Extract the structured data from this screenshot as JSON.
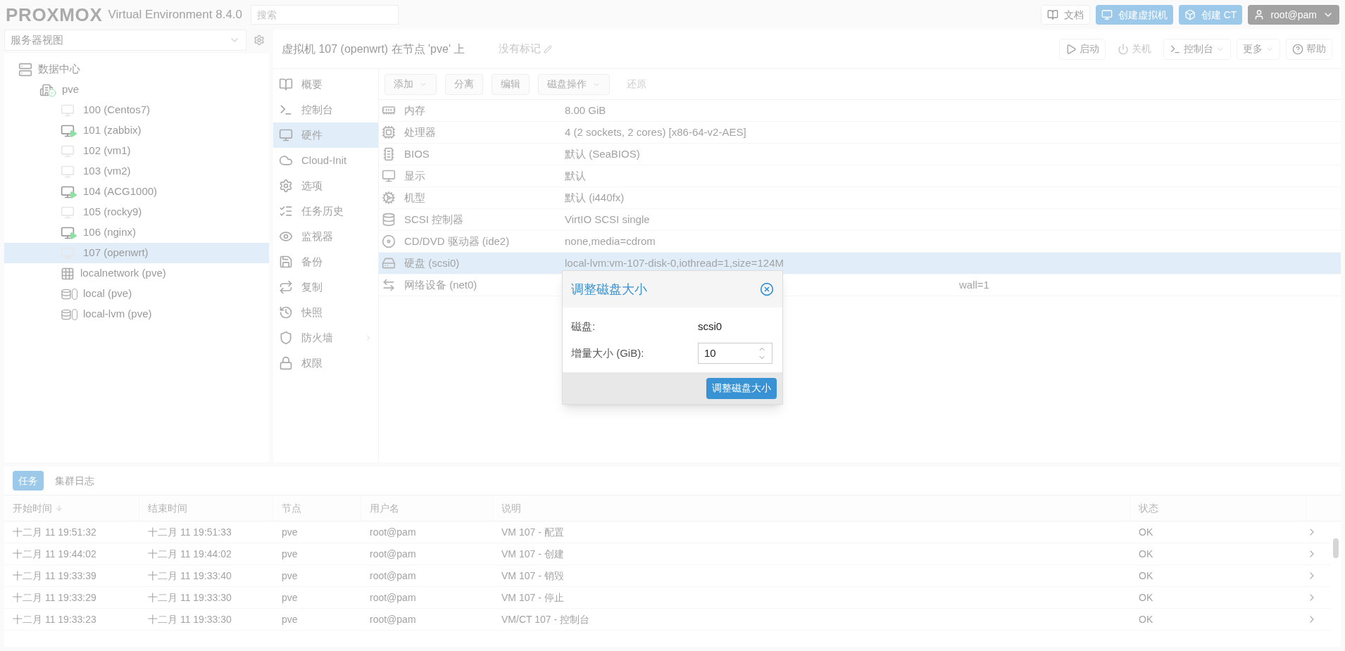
{
  "topbar": {
    "brand": "PROXMOX",
    "product": "Virtual Environment 8.4.0",
    "search": {
      "placeholder": "搜索"
    },
    "buttons": [
      {
        "label": "文档",
        "kind": "docs"
      },
      {
        "label": "创建虚拟机",
        "kind": "create-vm"
      },
      {
        "label": "创建 CT",
        "kind": "create-ct"
      },
      {
        "label": "root@pam",
        "kind": "user"
      }
    ]
  },
  "sidebar": {
    "view_select": {
      "value": "服务器视图"
    },
    "tree": [
      {
        "label": "数据中心",
        "kind": "datacenter",
        "selected": false,
        "children": [
          {
            "label": "pve",
            "kind": "node",
            "selected": false,
            "children": [
              {
                "label": "100 (Centos7)",
                "kind": "vm",
                "running": false,
                "selected": false
              },
              {
                "label": "101 (zabbix)",
                "kind": "vm",
                "running": true,
                "selected": false
              },
              {
                "label": "102 (vm1)",
                "kind": "vm",
                "running": false,
                "selected": false
              },
              {
                "label": "103 (vm2)",
                "kind": "vm",
                "running": false,
                "selected": false
              },
              {
                "label": "104 (ACG1000)",
                "kind": "vm",
                "running": true,
                "selected": false
              },
              {
                "label": "105 (rocky9)",
                "kind": "vm",
                "running": false,
                "selected": false
              },
              {
                "label": "106 (nginx)",
                "kind": "vm",
                "running": true,
                "selected": false
              },
              {
                "label": "107 (openwrt)",
                "kind": "vm",
                "running": false,
                "selected": true
              },
              {
                "label": "localnetwork (pve)",
                "kind": "sdn",
                "selected": false
              },
              {
                "label": "local (pve)",
                "kind": "storage",
                "selected": false
              },
              {
                "label": "local-lvm (pve)",
                "kind": "storage",
                "selected": false
              }
            ]
          }
        ]
      }
    ]
  },
  "content": {
    "title": "虚拟机 107 (openwrt) 在节点 'pve' 上",
    "tags": "没有标记",
    "actions": [
      {
        "label": "启动",
        "disabled": false
      },
      {
        "label": "关机",
        "disabled": true
      },
      {
        "label": "控制台",
        "disabled": false
      },
      {
        "label": "更多",
        "disabled": false
      },
      {
        "label": "帮助",
        "disabled": false
      }
    ],
    "nav": [
      {
        "label": "概要",
        "selected": false
      },
      {
        "label": "控制台",
        "selected": false
      },
      {
        "label": "硬件",
        "selected": true
      },
      {
        "label": "Cloud-Init",
        "selected": false
      },
      {
        "label": "选项",
        "selected": false
      },
      {
        "label": "任务历史",
        "selected": false
      },
      {
        "label": "监视器",
        "selected": false
      },
      {
        "label": "备份",
        "selected": false
      },
      {
        "label": "复制",
        "selected": false
      },
      {
        "label": "快照",
        "selected": false
      },
      {
        "label": "防火墙",
        "selected": false
      },
      {
        "label": "权限",
        "selected": false
      }
    ],
    "toolbar": [
      {
        "label": "添加",
        "disabled": false,
        "menu": true
      },
      {
        "label": "分离",
        "disabled": false,
        "menu": false
      },
      {
        "label": "编辑",
        "disabled": false,
        "menu": false
      },
      {
        "label": "磁盘操作",
        "disabled": false,
        "menu": true
      },
      {
        "label": "还原",
        "disabled": true,
        "menu": false
      }
    ],
    "hardware": [
      {
        "name": "内存",
        "value": "8.00 GiB",
        "selected": false,
        "covered": false
      },
      {
        "name": "处理器",
        "value": "4 (2 sockets, 2 cores) [x86-64-v2-AES]",
        "selected": false,
        "covered": false
      },
      {
        "name": "BIOS",
        "value": "默认 (SeaBIOS)",
        "selected": false,
        "covered": false
      },
      {
        "name": "显示",
        "value": "默认",
        "selected": false,
        "covered": false
      },
      {
        "name": "机型",
        "value": "默认 (i440fx)",
        "selected": false,
        "covered": false
      },
      {
        "name": "SCSI 控制器",
        "value": "VirtIO SCSI single",
        "selected": false,
        "covered": false
      },
      {
        "name": "CD/DVD 驱动器 (ide2)",
        "value": "none,media=cdrom",
        "selected": false,
        "covered": false
      },
      {
        "name": "硬盘 (scsi0)",
        "value": "local-lvm:vm-107-disk-0,iothread=1,size=124M",
        "selected": true,
        "covered": false
      },
      {
        "name": "网络设备 (net0)",
        "value": "wall=1",
        "selected": false,
        "covered": true
      }
    ]
  },
  "dialog": {
    "title": "调整磁盘大小",
    "fields": [
      {
        "label": "磁盘:",
        "kind": "display",
        "value": "scsi0"
      },
      {
        "label": "增量大小 (GiB):",
        "kind": "number",
        "value": "10"
      }
    ],
    "submit": "调整磁盘大小"
  },
  "log": {
    "tabs": [
      {
        "label": "任务",
        "selected": true
      },
      {
        "label": "集群日志",
        "selected": false
      }
    ],
    "columns": [
      "开始时间",
      "结束时间",
      "节点",
      "用户名",
      "说明",
      "状态"
    ],
    "rows": [
      [
        "十二月 11 19:51:32",
        "十二月 11 19:51:33",
        "pve",
        "root@pam",
        "VM 107 - 配置",
        "OK"
      ],
      [
        "十二月 11 19:44:02",
        "十二月 11 19:44:02",
        "pve",
        "root@pam",
        "VM 107 - 创建",
        "OK"
      ],
      [
        "十二月 11 19:33:39",
        "十二月 11 19:33:40",
        "pve",
        "root@pam",
        "VM 107 - 销毁",
        "OK"
      ],
      [
        "十二月 11 19:33:29",
        "十二月 11 19:33:30",
        "pve",
        "root@pam",
        "VM 107 - 停止",
        "OK"
      ],
      [
        "十二月 11 19:33:23",
        "十二月 11 19:33:30",
        "pve",
        "root@pam",
        "VM/CT 107 - 控制台",
        "OK"
      ]
    ]
  }
}
